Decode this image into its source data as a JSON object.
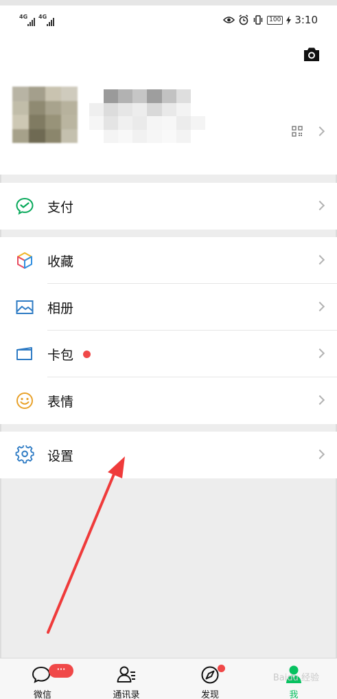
{
  "status_bar": {
    "network_1": "4G",
    "network_2": "4G",
    "battery": "100",
    "time": "3:10"
  },
  "menu": {
    "pay": "支付",
    "favorites": "收藏",
    "album": "相册",
    "cards": "卡包",
    "stickers": "表情",
    "settings": "设置"
  },
  "tabs": [
    {
      "label": "微信",
      "badge": "···"
    },
    {
      "label": "通讯录"
    },
    {
      "label": "发现"
    },
    {
      "label": "我"
    }
  ],
  "watermark": "Baidu 经验",
  "colors": {
    "accent_green": "#07c160",
    "badge_red": "#f04848",
    "annotation_arrow": "#ef3b3b"
  },
  "icons": {
    "pay": "wechat-pay-icon",
    "favorites": "cube-icon",
    "album": "picture-icon",
    "cards": "card-icon",
    "stickers": "smiley-icon",
    "settings": "gear-icon"
  }
}
